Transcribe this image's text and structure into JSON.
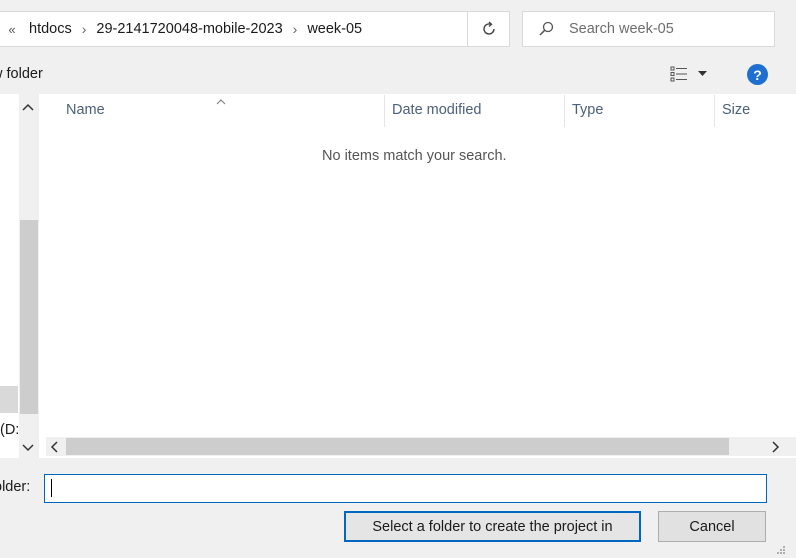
{
  "address_bar": {
    "overflow_glyph": "«",
    "breadcrumbs": [
      "htdocs",
      "29-2141720048-mobile-2023",
      "week-05"
    ]
  },
  "search": {
    "placeholder": "Search week-05"
  },
  "toolbar": {
    "new_folder_label": "w folder"
  },
  "help": {
    "label": "?"
  },
  "nav_pane": {
    "visible_item_label": "(D:)"
  },
  "columns": [
    {
      "label": "Name"
    },
    {
      "label": "Date modified"
    },
    {
      "label": "Type"
    },
    {
      "label": "Size"
    }
  ],
  "empty_message": "No items match your search.",
  "footer": {
    "folder_label": "older:",
    "folder_value": "",
    "primary_button": "Select a folder to create the project in",
    "cancel_button": "Cancel"
  },
  "colors": {
    "accent": "#0067c0",
    "help_icon": "#1e6fd0",
    "header_text": "#4c607a"
  }
}
